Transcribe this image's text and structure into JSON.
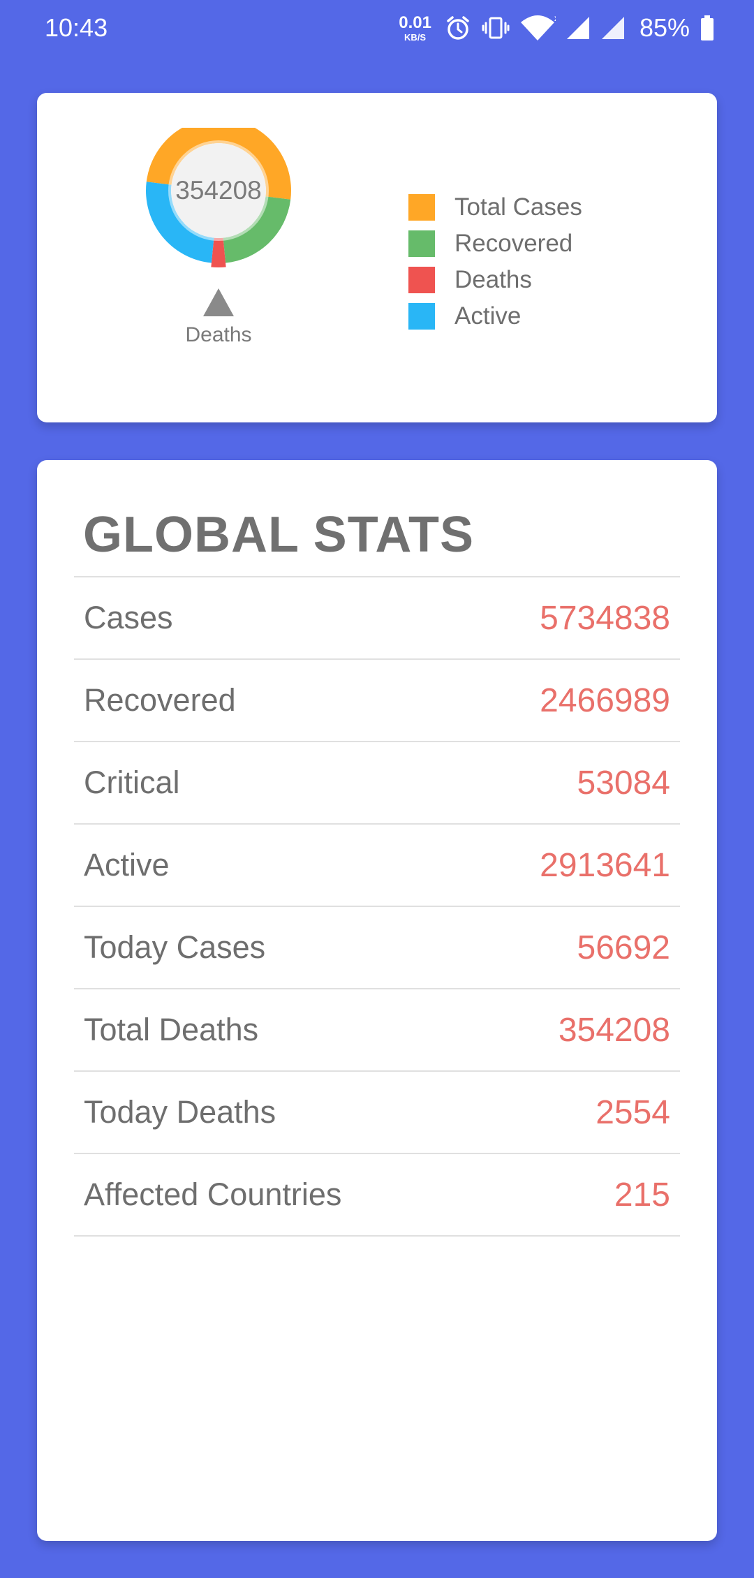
{
  "status_bar": {
    "time": "10:43",
    "net_speed_value": "0.01",
    "net_speed_unit": "KB/S",
    "battery": "85%",
    "icons": [
      "alarm-icon",
      "vibrate-icon",
      "wifi-icon",
      "signal-icon",
      "signal-icon",
      "battery-icon"
    ]
  },
  "chart": {
    "center_value": "354208",
    "pointer_label": "Deaths",
    "legend": [
      {
        "label": "Total Cases",
        "color": "#FFA726"
      },
      {
        "label": "Recovered",
        "color": "#66BB6A"
      },
      {
        "label": "Deaths",
        "color": "#EF5350"
      },
      {
        "label": "Active",
        "color": "#29B6F6"
      }
    ]
  },
  "chart_data": {
    "type": "pie",
    "categories": [
      "Total Cases",
      "Recovered",
      "Deaths",
      "Active"
    ],
    "values": [
      5734838,
      2466989,
      354208,
      2913641
    ],
    "colors": [
      "#FFA726",
      "#66BB6A",
      "#EF5350",
      "#29B6F6"
    ],
    "center_text": "354208",
    "highlight": "Deaths",
    "legend": "right"
  },
  "stats": {
    "title": "GLOBAL STATS",
    "rows": [
      {
        "label": "Cases",
        "value": "5734838"
      },
      {
        "label": "Recovered",
        "value": "2466989"
      },
      {
        "label": "Critical",
        "value": "53084"
      },
      {
        "label": "Active",
        "value": "2913641"
      },
      {
        "label": "Today Cases",
        "value": "56692"
      },
      {
        "label": "Total Deaths",
        "value": "354208"
      },
      {
        "label": "Today Deaths",
        "value": "2554"
      },
      {
        "label": "Affected Countries",
        "value": "215"
      }
    ]
  }
}
